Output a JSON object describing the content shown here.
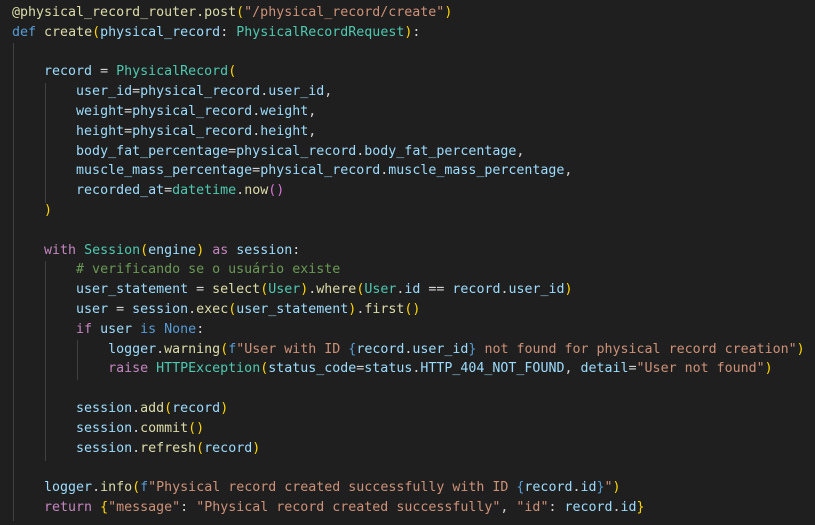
{
  "editor": {
    "language": "python",
    "theme": {
      "background": "#1f1f1f",
      "default": "#d4d4d4",
      "keyword": "#569cd6",
      "control": "#c586c0",
      "function": "#dcdcaa",
      "variable": "#9cdcfe",
      "string": "#ce9178",
      "class": "#4ec9b0",
      "comment": "#6a9955",
      "bracket1": "#ffd700",
      "bracket2": "#da70d6",
      "bracket3": "#179fff"
    },
    "lines": [
      [
        [
          "fn",
          "@physical_record_router.post"
        ],
        [
          "br1",
          "("
        ],
        [
          "str",
          "\"/physical_record/create\""
        ],
        [
          "br1",
          ")"
        ]
      ],
      [
        [
          "kw",
          "def"
        ],
        [
          "op",
          " "
        ],
        [
          "fn",
          "create"
        ],
        [
          "br1",
          "("
        ],
        [
          "var",
          "physical_record"
        ],
        [
          "op",
          ": "
        ],
        [
          "cls",
          "PhysicalRecordRequest"
        ],
        [
          "br1",
          ")"
        ],
        [
          "op",
          ":"
        ]
      ],
      [],
      [
        [
          "var",
          "record"
        ],
        [
          "op",
          " = "
        ],
        [
          "cls",
          "PhysicalRecord"
        ],
        [
          "br1",
          "("
        ]
      ],
      [
        [
          "var",
          "user_id"
        ],
        [
          "op",
          "="
        ],
        [
          "var",
          "physical_record"
        ],
        [
          "op",
          "."
        ],
        [
          "var",
          "user_id"
        ],
        [
          "op",
          ","
        ]
      ],
      [
        [
          "var",
          "weight"
        ],
        [
          "op",
          "="
        ],
        [
          "var",
          "physical_record"
        ],
        [
          "op",
          "."
        ],
        [
          "var",
          "weight"
        ],
        [
          "op",
          ","
        ]
      ],
      [
        [
          "var",
          "height"
        ],
        [
          "op",
          "="
        ],
        [
          "var",
          "physical_record"
        ],
        [
          "op",
          "."
        ],
        [
          "var",
          "height"
        ],
        [
          "op",
          ","
        ]
      ],
      [
        [
          "var",
          "body_fat_percentage"
        ],
        [
          "op",
          "="
        ],
        [
          "var",
          "physical_record"
        ],
        [
          "op",
          "."
        ],
        [
          "var",
          "body_fat_percentage"
        ],
        [
          "op",
          ","
        ]
      ],
      [
        [
          "var",
          "muscle_mass_percentage"
        ],
        [
          "op",
          "="
        ],
        [
          "var",
          "physical_record"
        ],
        [
          "op",
          "."
        ],
        [
          "var",
          "muscle_mass_percentage"
        ],
        [
          "op",
          ","
        ]
      ],
      [
        [
          "var",
          "recorded_at"
        ],
        [
          "op",
          "="
        ],
        [
          "cls",
          "datetime"
        ],
        [
          "op",
          "."
        ],
        [
          "fn",
          "now"
        ],
        [
          "br2",
          "()"
        ]
      ],
      [
        [
          "br1",
          ")"
        ]
      ],
      [],
      [
        [
          "ctl",
          "with"
        ],
        [
          "op",
          " "
        ],
        [
          "cls",
          "Session"
        ],
        [
          "br1",
          "("
        ],
        [
          "var",
          "engine"
        ],
        [
          "br1",
          ")"
        ],
        [
          "op",
          " "
        ],
        [
          "ctl",
          "as"
        ],
        [
          "op",
          " "
        ],
        [
          "var",
          "session"
        ],
        [
          "op",
          ":"
        ]
      ],
      [
        [
          "cm",
          "# verificando se o usuário existe"
        ]
      ],
      [
        [
          "var",
          "user_statement"
        ],
        [
          "op",
          " = "
        ],
        [
          "fn",
          "select"
        ],
        [
          "br1",
          "("
        ],
        [
          "cls",
          "User"
        ],
        [
          "br1",
          ")"
        ],
        [
          "op",
          "."
        ],
        [
          "fn",
          "where"
        ],
        [
          "br1",
          "("
        ],
        [
          "cls",
          "User"
        ],
        [
          "op",
          "."
        ],
        [
          "var",
          "id"
        ],
        [
          "op",
          " == "
        ],
        [
          "var",
          "record"
        ],
        [
          "op",
          "."
        ],
        [
          "var",
          "user_id"
        ],
        [
          "br1",
          ")"
        ]
      ],
      [
        [
          "var",
          "user"
        ],
        [
          "op",
          " = "
        ],
        [
          "var",
          "session"
        ],
        [
          "op",
          "."
        ],
        [
          "fn",
          "exec"
        ],
        [
          "br1",
          "("
        ],
        [
          "var",
          "user_statement"
        ],
        [
          "br1",
          ")"
        ],
        [
          "op",
          "."
        ],
        [
          "fn",
          "first"
        ],
        [
          "br1",
          "()"
        ]
      ],
      [
        [
          "ctl",
          "if"
        ],
        [
          "op",
          " "
        ],
        [
          "var",
          "user"
        ],
        [
          "op",
          " "
        ],
        [
          "kw",
          "is"
        ],
        [
          "op",
          " "
        ],
        [
          "kw",
          "None"
        ],
        [
          "op",
          ":"
        ]
      ],
      [
        [
          "var",
          "logger"
        ],
        [
          "op",
          "."
        ],
        [
          "fn",
          "warning"
        ],
        [
          "br1",
          "("
        ],
        [
          "kw",
          "f"
        ],
        [
          "str",
          "\"User with ID "
        ],
        [
          "kw",
          "{"
        ],
        [
          "var",
          "record"
        ],
        [
          "op",
          "."
        ],
        [
          "var",
          "user_id"
        ],
        [
          "kw",
          "}"
        ],
        [
          "str",
          " not found for physical record creation\""
        ],
        [
          "br1",
          ")"
        ]
      ],
      [
        [
          "ctl",
          "raise"
        ],
        [
          "op",
          " "
        ],
        [
          "cls",
          "HTTPException"
        ],
        [
          "br1",
          "("
        ],
        [
          "var",
          "status_code"
        ],
        [
          "op",
          "="
        ],
        [
          "var",
          "status"
        ],
        [
          "op",
          "."
        ],
        [
          "var",
          "HTTP_404_NOT_FOUND"
        ],
        [
          "op",
          ", "
        ],
        [
          "var",
          "detail"
        ],
        [
          "op",
          "="
        ],
        [
          "str",
          "\"User not found\""
        ],
        [
          "br1",
          ")"
        ]
      ],
      [],
      [
        [
          "var",
          "session"
        ],
        [
          "op",
          "."
        ],
        [
          "fn",
          "add"
        ],
        [
          "br1",
          "("
        ],
        [
          "var",
          "record"
        ],
        [
          "br1",
          ")"
        ]
      ],
      [
        [
          "var",
          "session"
        ],
        [
          "op",
          "."
        ],
        [
          "fn",
          "commit"
        ],
        [
          "br1",
          "()"
        ]
      ],
      [
        [
          "var",
          "session"
        ],
        [
          "op",
          "."
        ],
        [
          "fn",
          "refresh"
        ],
        [
          "br1",
          "("
        ],
        [
          "var",
          "record"
        ],
        [
          "br1",
          ")"
        ]
      ],
      [],
      [
        [
          "var",
          "logger"
        ],
        [
          "op",
          "."
        ],
        [
          "fn",
          "info"
        ],
        [
          "br1",
          "("
        ],
        [
          "kw",
          "f"
        ],
        [
          "str",
          "\"Physical record created successfully with ID "
        ],
        [
          "kw",
          "{"
        ],
        [
          "var",
          "record"
        ],
        [
          "op",
          "."
        ],
        [
          "var",
          "id"
        ],
        [
          "kw",
          "}"
        ],
        [
          "str",
          "\""
        ],
        [
          "br1",
          ")"
        ]
      ],
      [
        [
          "ctl",
          "return"
        ],
        [
          "op",
          " "
        ],
        [
          "br1",
          "{"
        ],
        [
          "str",
          "\"message\""
        ],
        [
          "op",
          ": "
        ],
        [
          "str",
          "\"Physical record created successfully\""
        ],
        [
          "op",
          ", "
        ],
        [
          "str",
          "\"id\""
        ],
        [
          "op",
          ": "
        ],
        [
          "var",
          "record"
        ],
        [
          "op",
          "."
        ],
        [
          "var",
          "id"
        ],
        [
          "br1",
          "}"
        ]
      ]
    ]
  }
}
